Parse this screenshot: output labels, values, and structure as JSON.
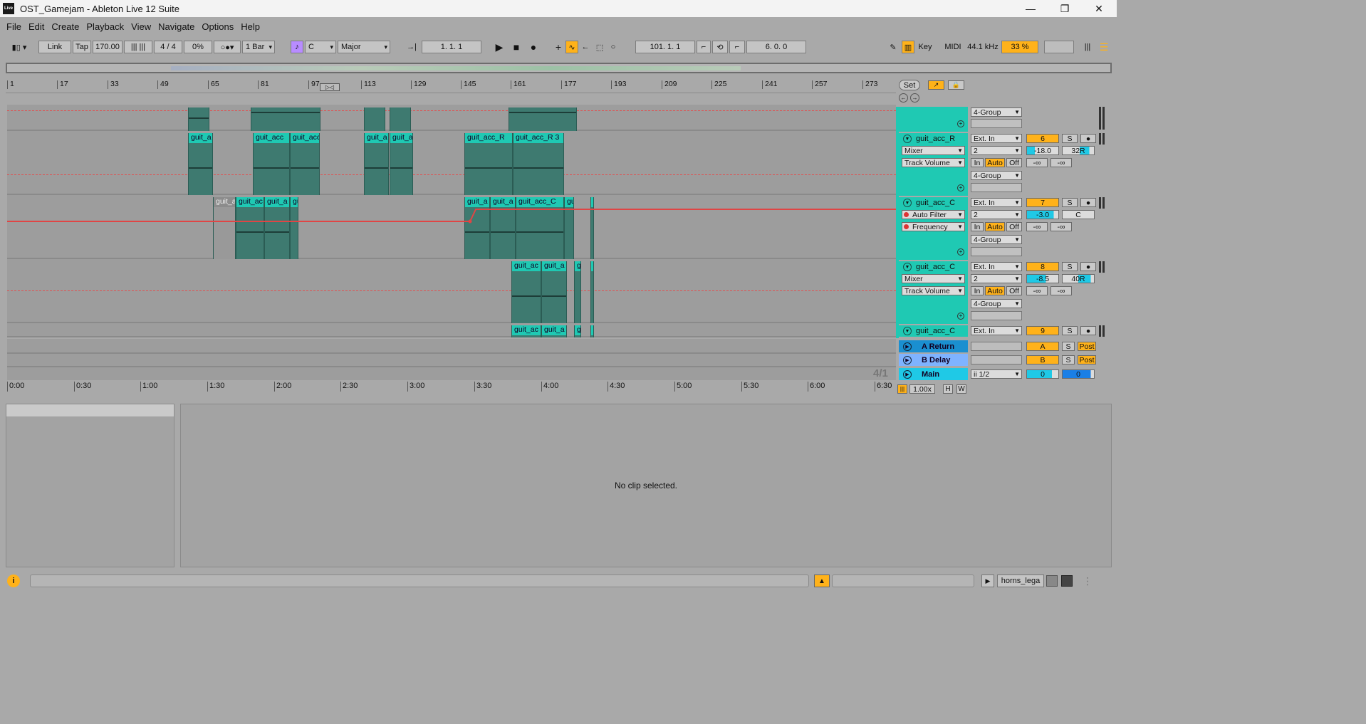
{
  "window": {
    "title": "OST_Gamejam - Ableton Live 12 Suite",
    "logo": "Live",
    "minimize": "—",
    "restore": "❐",
    "close": "✕"
  },
  "menu": [
    "File",
    "Edit",
    "Create",
    "Playback",
    "View",
    "Navigate",
    "Options",
    "Help"
  ],
  "control": {
    "link": "Link",
    "tap": "Tap",
    "tempo": "170.00",
    "signature": "4 / 4",
    "groove": "0%",
    "quantize": "1 Bar",
    "key_root": "C",
    "scale": "Major",
    "arr_position": "1.   1.   1",
    "loop_start": "101.   1.   1",
    "loop_length": "6.   0.   0",
    "key": "Key",
    "midi": "MIDI",
    "sample_rate": "44.1 kHz",
    "cpu": "33 %"
  },
  "ruler": [
    "1",
    "17",
    "33",
    "49",
    "65",
    "81",
    "97",
    "113",
    "129",
    "145",
    "161",
    "177",
    "193",
    "209",
    "225",
    "241",
    "257",
    "273"
  ],
  "time": [
    "0:00",
    "0:30",
    "1:00",
    "1:30",
    "2:00",
    "2:30",
    "3:00",
    "3:30",
    "4:00",
    "4:30",
    "5:00",
    "5:30",
    "6:00",
    "6:30"
  ],
  "set_button": "Set",
  "tracks": [
    {
      "name": "guit_acc_R",
      "input": "Ext. In",
      "device": "Mixer",
      "param": "Track Volume",
      "channel": "2",
      "group": "4-Group",
      "number": "6",
      "volume": "-18.0",
      "pan": "32R",
      "in": "In",
      "auto": "Auto",
      "off": "Off",
      "peak1": "-∞",
      "peak2": "-∞",
      "solo": "S"
    },
    {
      "name": "guit_acc_C",
      "input": "Ext. In",
      "device": "Auto Filter",
      "param": "Frequency",
      "channel": "2",
      "group": "4-Group",
      "number": "7",
      "volume": "-3.0",
      "pan": "C",
      "in": "In",
      "auto": "Auto",
      "off": "Off",
      "peak1": "-∞",
      "peak2": "-∞",
      "solo": "S"
    },
    {
      "name": "guit_acc_C",
      "input": "Ext. In",
      "device": "Mixer",
      "param": "Track Volume",
      "channel": "2",
      "group": "4-Group",
      "number": "8",
      "volume": "-8.5",
      "pan": "40R",
      "in": "In",
      "auto": "Auto",
      "off": "Off",
      "peak1": "-∞",
      "peak2": "-∞",
      "solo": "S"
    },
    {
      "name": "guit_acc_C",
      "input": "Ext. In",
      "number": "9",
      "solo": "S"
    }
  ],
  "top_group": "4-Group",
  "returns": [
    {
      "name": "A Return",
      "letter": "A",
      "solo": "S",
      "post": "Post"
    },
    {
      "name": "B Delay",
      "letter": "B",
      "solo": "S",
      "post": "Post"
    }
  ],
  "main": {
    "name": "Main",
    "output": "ii 1/2",
    "vol1": "0",
    "vol2": "0"
  },
  "time_sig_display": "4/1",
  "zoom": "1.00x",
  "h_btn": "H",
  "w_btn": "W",
  "clips": {
    "row2": [
      "guit_a",
      "guit_acc",
      "guit_acc",
      "guit_a",
      "guit_a",
      "guit_acc_R",
      "guit_acc_R 3"
    ],
    "row3": [
      "guit_a",
      "guit_ac",
      "guit_a",
      "gu",
      "guit_a",
      "guit_a",
      "guit_acc_C",
      "gu",
      "g"
    ],
    "row4": [
      "guit_ac",
      "guit_a",
      "g",
      "g"
    ],
    "row5": [
      "guit_ac",
      "guit_a",
      "g",
      "g"
    ]
  },
  "detail": {
    "empty": "No clip selected."
  },
  "status": {
    "file": "horns_lega"
  }
}
